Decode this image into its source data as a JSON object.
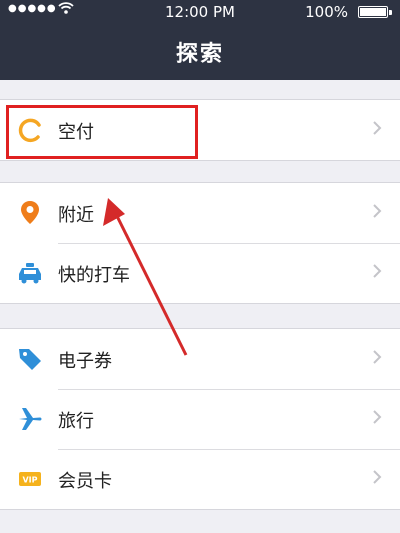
{
  "status_bar": {
    "signal": "●●●●●",
    "time": "12:00 PM",
    "battery": "100%"
  },
  "nav": {
    "title": "探索"
  },
  "groups": [
    {
      "items": [
        {
          "label": "空付",
          "icon": "kongfu-ring-icon"
        }
      ]
    },
    {
      "items": [
        {
          "label": "附近",
          "icon": "location-pin-icon"
        },
        {
          "label": "快的打车",
          "icon": "taxi-icon"
        }
      ]
    },
    {
      "items": [
        {
          "label": "电子券",
          "icon": "coupon-tag-icon"
        },
        {
          "label": "旅行",
          "icon": "airplane-icon"
        },
        {
          "label": "会员卡",
          "icon": "vip-card-icon",
          "badge": "VIP"
        }
      ]
    }
  ],
  "colors": {
    "header_bg": "#2d3342",
    "highlight": "#e02020",
    "kongfu_orange": "#f5a623",
    "pin_orange": "#ef7d1a",
    "blue": "#2f8fd8"
  }
}
